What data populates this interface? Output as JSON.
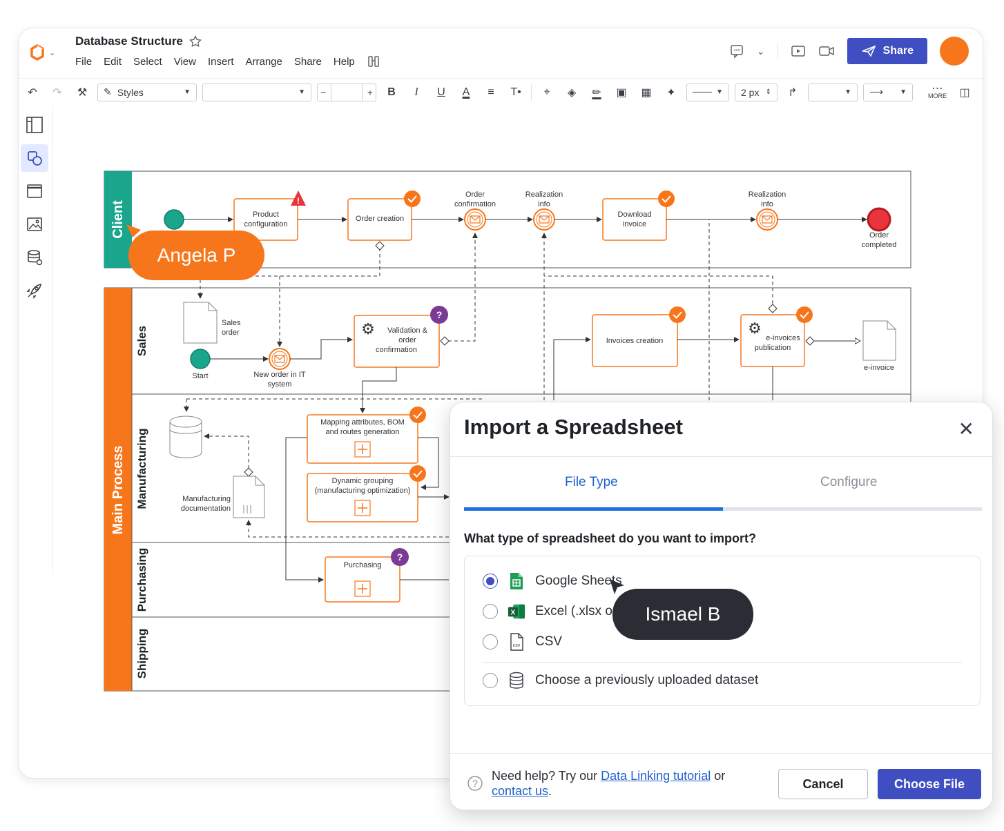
{
  "app": {
    "doc_title": "Database Structure",
    "menu": [
      "File",
      "Edit",
      "Select",
      "View",
      "Insert",
      "Arrange",
      "Share",
      "Help"
    ],
    "share_label": "Share",
    "colors": {
      "accent": "#3f4fc2",
      "orange": "#f8761b",
      "teal": "#1aa58d",
      "avatar": "#f8761b"
    }
  },
  "toolbar": {
    "styles_label": "Styles",
    "line_width": "2 px",
    "more_label": "MORE"
  },
  "diagram": {
    "pools": {
      "client": "Client",
      "main": "Main Process"
    },
    "lanes": {
      "sales": "Sales",
      "manufacturing": "Manufacturing",
      "purchasing": "Purchasing",
      "shipping": "Shipping"
    },
    "client": {
      "product_config": [
        "Product",
        "configuration"
      ],
      "order_creation": "Order creation",
      "order_confirmation": [
        "Order",
        "confirmation"
      ],
      "realization_info": [
        "Realization",
        "info"
      ],
      "download_invoice": [
        "Download",
        "invoice"
      ],
      "realization_info2": [
        "Realization",
        "info"
      ],
      "order_completed": [
        "Order",
        "completed"
      ]
    },
    "sales": {
      "sales_order": [
        "Sales",
        "order"
      ],
      "start": "Start",
      "new_order": [
        "New order in IT",
        "system"
      ],
      "validation": [
        "Validation &",
        "order",
        "confirmation"
      ],
      "invoices_creation": "Invoices creation",
      "einvoices_pub": [
        "e-invoices",
        "publication"
      ],
      "einvoice": "e-invoice"
    },
    "manufacturing": {
      "mapping": [
        "Mapping attributes, BOM",
        "and routes generation"
      ],
      "grouping": [
        "Dynamic grouping",
        "(manufacturing optimization)"
      ],
      "documentation": [
        "Manufacturing",
        "documentation"
      ]
    },
    "purchasing": {
      "purchasing": "Purchasing"
    }
  },
  "collaborators": {
    "angela": "Angela P",
    "ismael": "Ismael B"
  },
  "dialog": {
    "title": "Import a Spreadsheet",
    "tabs": [
      "File Type",
      "Configure"
    ],
    "progress": 0.5,
    "question": "What type of spreadsheet do you want to import?",
    "options": [
      {
        "label": "Google Sheets",
        "selected": true,
        "icon": "google-sheets-icon"
      },
      {
        "label": "Excel (.xlsx or",
        "selected": false,
        "icon": "excel-icon"
      },
      {
        "label": "CSV",
        "selected": false,
        "icon": "csv-icon"
      },
      {
        "label": "Choose a previously uploaded dataset",
        "selected": false,
        "icon": "database-icon"
      }
    ],
    "help_prefix": "Need help? Try our",
    "help_link1": "Data Linking tutorial",
    "help_or": "or",
    "help_link2": "contact us",
    "help_suffix": ".",
    "cancel": "Cancel",
    "choose": "Choose File"
  }
}
